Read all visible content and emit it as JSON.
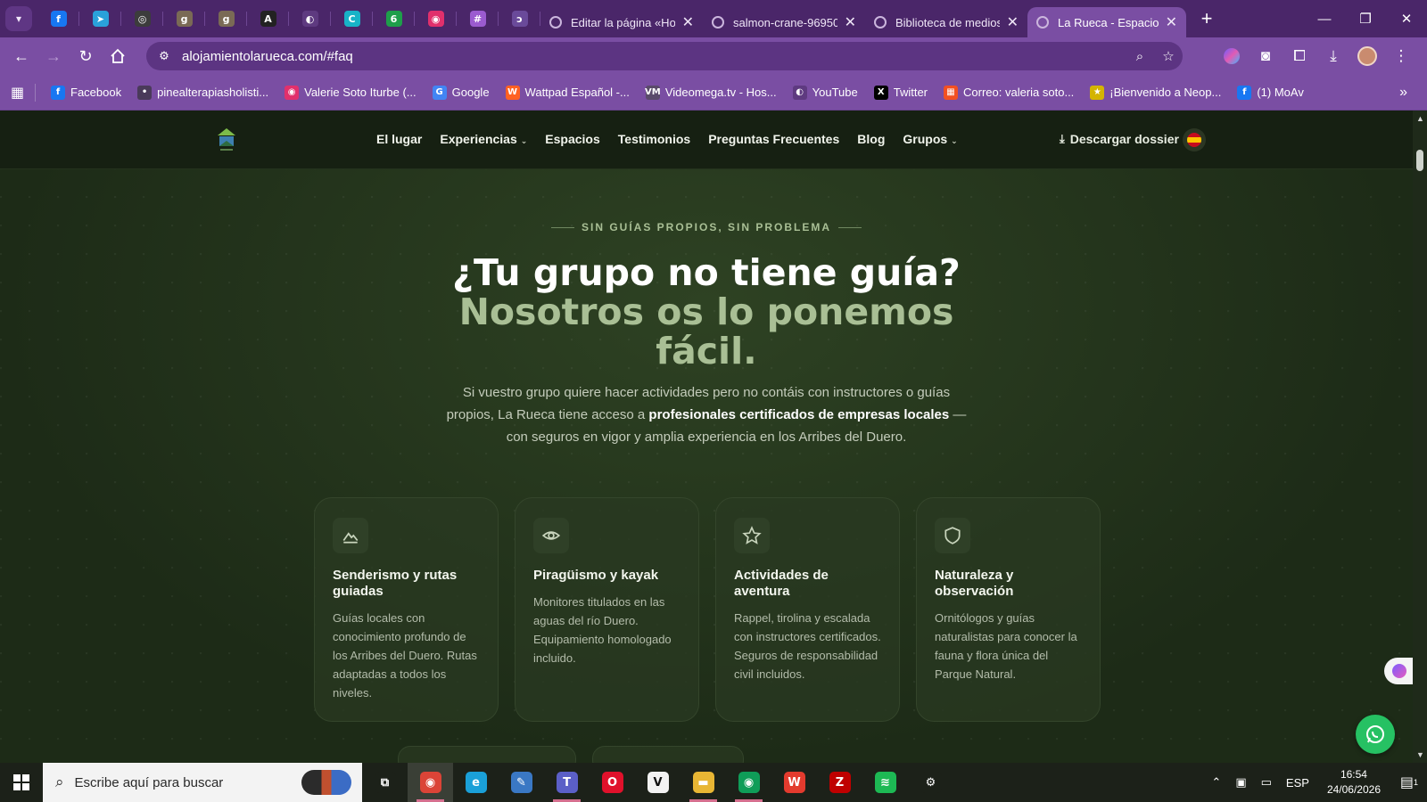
{
  "browser": {
    "tabs": [
      {
        "title": "Editar la página «Hor",
        "active": false
      },
      {
        "title": "salmon-crane-96950",
        "active": false
      },
      {
        "title": "Biblioteca de medios",
        "active": false
      },
      {
        "title": "La Rueca - Espacio p",
        "active": true
      }
    ],
    "pinned_tabs": [
      {
        "icon": "facebook-icon",
        "glyph": "f",
        "color": "#1877f2"
      },
      {
        "icon": "telegram-icon",
        "glyph": "➤",
        "color": "#2aa1da"
      },
      {
        "icon": "chatgpt-icon",
        "glyph": "◎",
        "color": "#3c3c3c"
      },
      {
        "icon": "goodreads-icon",
        "glyph": "g",
        "color": "#7a6a55"
      },
      {
        "icon": "goodreads-icon",
        "glyph": "g",
        "color": "#7a6a55"
      },
      {
        "icon": "font-a-icon",
        "glyph": "A",
        "color": "#222222"
      },
      {
        "icon": "globe-icon",
        "glyph": "◐",
        "color": "#5e3a80"
      },
      {
        "icon": "canva-icon",
        "glyph": "C",
        "color": "#18b3c7"
      },
      {
        "icon": "green-six-icon",
        "glyph": "6",
        "color": "#1e9e4a"
      },
      {
        "icon": "instagram-icon",
        "glyph": "◉",
        "color": "#e1306c"
      },
      {
        "icon": "slack-icon",
        "glyph": "#",
        "color": "#9b5bd0"
      },
      {
        "icon": "stylus-icon",
        "glyph": "ↄ",
        "color": "#6a4a9a"
      }
    ],
    "new_tab_label": "+",
    "url": "alojamientolarueca.com/#faq",
    "bookmarks": [
      {
        "label": "Facebook",
        "icon": "facebook-icon",
        "glyph": "f",
        "color": "#1877f2"
      },
      {
        "label": "pinealterapiasholisti...",
        "icon": "dot-icon",
        "glyph": "•",
        "color": "#4a3a5a"
      },
      {
        "label": "Valerie Soto Iturbe (...",
        "icon": "instagram-icon",
        "glyph": "◉",
        "color": "#e1306c"
      },
      {
        "label": "Google",
        "icon": "google-icon",
        "glyph": "G",
        "color": "#4285f4"
      },
      {
        "label": "Wattpad Español -...",
        "icon": "wattpad-icon",
        "glyph": "W",
        "color": "#ff6122"
      },
      {
        "label": "Videomega.tv - Hos...",
        "icon": "vm-icon",
        "glyph": "VM",
        "color": "#5a4a6a"
      },
      {
        "label": "YouTube",
        "icon": "globe-icon",
        "glyph": "◐",
        "color": "#5e3a80"
      },
      {
        "label": "Twitter",
        "icon": "x-logo-icon",
        "glyph": "X",
        "color": "#000000"
      },
      {
        "label": "Correo: valeria soto...",
        "icon": "microsoft-icon",
        "glyph": "▦",
        "color": "#f25022"
      },
      {
        "label": "¡Bienvenido a Neop...",
        "icon": "star-icon",
        "glyph": "★",
        "color": "#d4b400"
      },
      {
        "label": "(1) MoAv",
        "icon": "facebook-icon",
        "glyph": "f",
        "color": "#1877f2"
      }
    ]
  },
  "site": {
    "nav": [
      {
        "label": "El lugar",
        "dropdown": false
      },
      {
        "label": "Experiencias",
        "dropdown": true
      },
      {
        "label": "Espacios",
        "dropdown": false
      },
      {
        "label": "Testimonios",
        "dropdown": false
      },
      {
        "label": "Preguntas Frecuentes",
        "dropdown": false
      },
      {
        "label": "Blog",
        "dropdown": false
      },
      {
        "label": "Grupos",
        "dropdown": true
      }
    ],
    "download_label": "Descargar dossier",
    "eyebrow": "SIN GUÍAS PROPIOS, SIN PROBLEMA",
    "heading_line1": "¿Tu grupo no tiene guía?",
    "heading_line2": "Nosotros os lo ponemos",
    "heading_line3": "fácil.",
    "lead_pre": "Si vuestro grupo quiere hacer actividades pero no contáis con instructores o guías propios, La Rueca tiene acceso a ",
    "lead_bold": "profesionales certificados de empresas locales",
    "lead_post": " — con seguros en vigor y amplia experiencia en los Arribes del Duero.",
    "cards": [
      {
        "icon": "mountain-icon",
        "title": "Senderismo y rutas guiadas",
        "desc": "Guías locales con conocimiento profundo de los Arribes del Duero. Rutas adaptadas a todos los niveles."
      },
      {
        "icon": "eye-icon",
        "title": "Piragüismo y kayak",
        "desc": "Monitores titulados en las aguas del río Duero. Equipamiento homologado incluido."
      },
      {
        "icon": "star-icon",
        "title": "Actividades de aventura",
        "desc": "Rappel, tirolina y escalada con instructores certificados. Seguros de responsabilidad civil incluidos."
      },
      {
        "icon": "shield-icon",
        "title": "Naturaleza y observación",
        "desc": "Ornitólogos y guías naturalistas para conocer la fauna y flora única del Parque Natural."
      }
    ]
  },
  "taskbar": {
    "search_placeholder": "Escribe aquí para buscar",
    "apps": [
      {
        "icon": "task-view-icon",
        "glyph": "⧉",
        "color": "#1c2119",
        "open": false,
        "active": false
      },
      {
        "icon": "chrome-icon",
        "glyph": "◉",
        "color": "#db4437",
        "open": true,
        "active": true
      },
      {
        "icon": "edge-icon",
        "glyph": "e",
        "color": "#1aa0d8",
        "open": false,
        "active": false
      },
      {
        "icon": "paint-icon",
        "glyph": "✎",
        "color": "#3a78c4",
        "open": false,
        "active": false
      },
      {
        "icon": "teams-icon",
        "glyph": "T",
        "color": "#5b5fc7",
        "open": true,
        "active": false
      },
      {
        "icon": "opera-icon",
        "glyph": "O",
        "color": "#e0112b",
        "open": false,
        "active": false
      },
      {
        "icon": "v-app-icon",
        "glyph": "V",
        "color": "#f2f2f2",
        "open": false,
        "active": false
      },
      {
        "icon": "file-explorer-icon",
        "glyph": "▬",
        "color": "#e8b634",
        "open": true,
        "active": false
      },
      {
        "icon": "chrome-profile-icon",
        "glyph": "◉",
        "color": "#0f9d58",
        "open": true,
        "active": false
      },
      {
        "icon": "wps-icon",
        "glyph": "W",
        "color": "#e33b2e",
        "open": false,
        "active": false
      },
      {
        "icon": "filezilla-icon",
        "glyph": "Z",
        "color": "#bf0000",
        "open": false,
        "active": false
      },
      {
        "icon": "spotify-icon",
        "glyph": "≋",
        "color": "#1db954",
        "open": false,
        "active": false
      },
      {
        "icon": "settings-icon",
        "glyph": "⚙",
        "color": "#1c2119",
        "open": false,
        "active": false
      }
    ],
    "language": "ESP",
    "time": "16:54",
    "date": "24/06/2026",
    "notification_count": "1"
  }
}
